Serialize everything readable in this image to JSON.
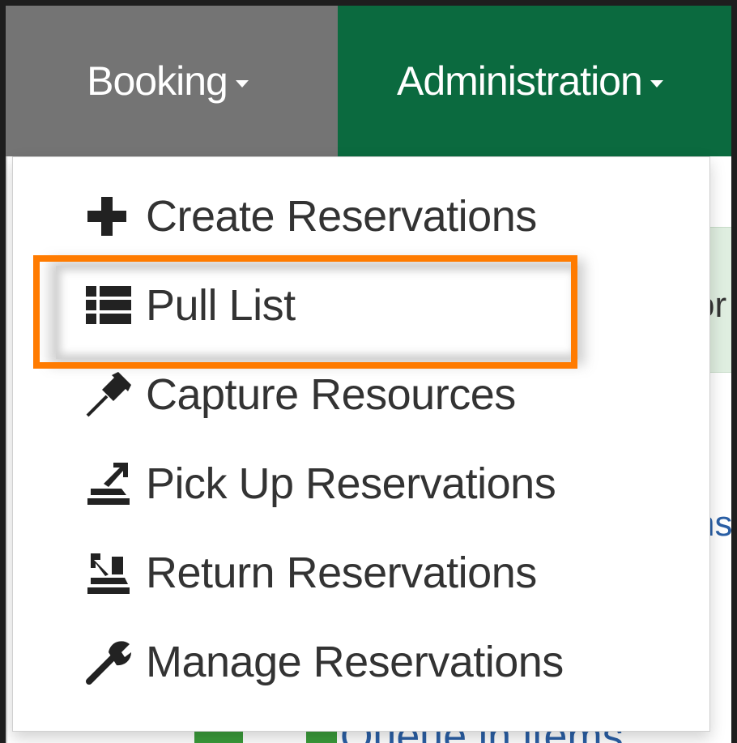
{
  "navbar": {
    "booking_label": "Booking",
    "administration_label": "Administration",
    "colors": {
      "nav_green": "#0b6a3f",
      "active_gray": "#747474"
    }
  },
  "dropdown": {
    "items": [
      {
        "label": "Create Reservations",
        "icon": "plus-icon"
      },
      {
        "label": "Pull List",
        "icon": "list-icon",
        "highlighted": true
      },
      {
        "label": "Capture Resources",
        "icon": "pushpin-icon"
      },
      {
        "label": "Pick Up Reservations",
        "icon": "pickup-icon"
      },
      {
        "label": "Return Reservations",
        "icon": "return-icon"
      },
      {
        "label": "Manage Reservations",
        "icon": "wrench-icon"
      }
    ],
    "highlight_color": "#ff7b00"
  },
  "background": {
    "partial_text_1": "or",
    "partial_link_1": "ns",
    "partial_bottom_link": "Queue in items"
  }
}
